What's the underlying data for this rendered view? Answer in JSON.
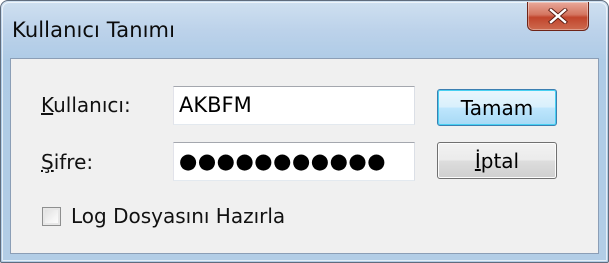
{
  "window": {
    "title": "Kullanıcı Tanımı",
    "close_glyph": "X"
  },
  "form": {
    "user_label_accel": "K",
    "user_label_rest": "ullanıcı:",
    "user_value": "AKBFM",
    "password_label_accel": "Ş",
    "password_label_rest": "ifre:",
    "password_mask": "●●●●●●●●●●●",
    "password_length": 11,
    "log_checkbox_checked": false,
    "log_checkbox_label": "Log Dosyasını Hazırla"
  },
  "buttons": {
    "ok_label": "Tamam",
    "cancel_label_accel": "İ",
    "cancel_label_rest": "ptal"
  },
  "colors": {
    "titlebar": "#bcd2ea",
    "close_button": "#c1452c",
    "default_button_border": "#3c7fb1",
    "client_background": "#f0f0f0"
  },
  "icons": {
    "close": "close-icon"
  }
}
